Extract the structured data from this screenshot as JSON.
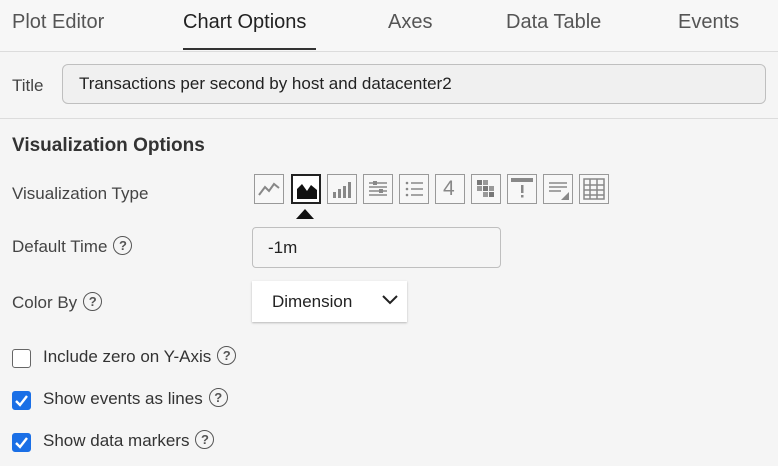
{
  "tabs": [
    {
      "label": "Plot Editor",
      "active": false
    },
    {
      "label": "Chart Options",
      "active": true
    },
    {
      "label": "Axes",
      "active": false
    },
    {
      "label": "Data Table",
      "active": false
    },
    {
      "label": "Events",
      "active": false
    }
  ],
  "title": {
    "label": "Title",
    "value": "Transactions per second by host and datacenter2"
  },
  "visualization": {
    "section_title": "Visualization Options",
    "type_label": "Visualization Type",
    "types": [
      {
        "icon": "line-chart-icon",
        "selected": false
      },
      {
        "icon": "area-chart-icon",
        "selected": true
      },
      {
        "icon": "column-chart-icon",
        "selected": false
      },
      {
        "icon": "histogram-icon",
        "selected": false
      },
      {
        "icon": "list-icon",
        "selected": false
      },
      {
        "icon": "single-value-icon",
        "selected": false,
        "text": "4"
      },
      {
        "icon": "heatmap-icon",
        "selected": false
      },
      {
        "icon": "event-feed-icon",
        "selected": false
      },
      {
        "icon": "text-note-icon",
        "selected": false
      },
      {
        "icon": "table-icon",
        "selected": false
      }
    ]
  },
  "default_time": {
    "label": "Default Time",
    "value": "-1m"
  },
  "color_by": {
    "label": "Color By",
    "value": "Dimension"
  },
  "options": {
    "include_zero": {
      "label": "Include zero on Y-Axis",
      "checked": false
    },
    "show_events": {
      "label": "Show events as lines",
      "checked": true
    },
    "show_markers": {
      "label": "Show data markers",
      "checked": true
    }
  },
  "colors": {
    "accent": "#1a6fe6",
    "background": "#f5f5f5"
  }
}
